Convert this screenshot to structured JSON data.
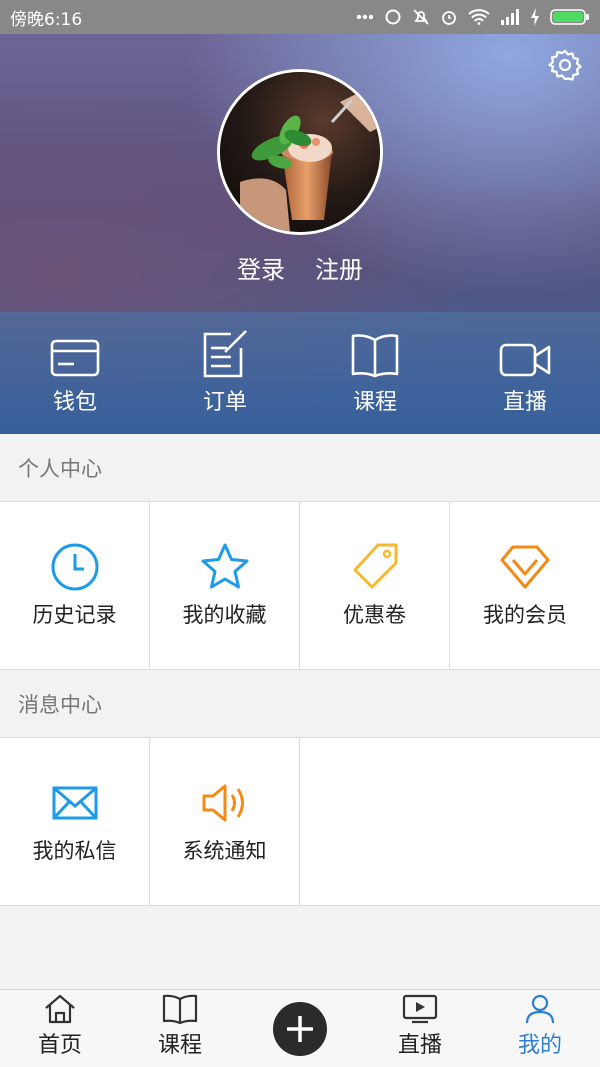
{
  "status_bar": {
    "time": "傍晚6:16",
    "icons": [
      "more-dots-icon",
      "sync-icon",
      "mute-icon",
      "alarm-icon",
      "wifi-icon",
      "signal-icon",
      "charging-icon",
      "battery-icon"
    ]
  },
  "header": {
    "settings_icon": "gear-icon",
    "avatar": "drink-photo",
    "login_label": "登录",
    "register_label": "注册"
  },
  "quick_actions": [
    {
      "label": "钱包",
      "icon": "wallet-icon"
    },
    {
      "label": "订单",
      "icon": "order-icon"
    },
    {
      "label": "课程",
      "icon": "book-icon"
    },
    {
      "label": "直播",
      "icon": "video-icon"
    }
  ],
  "personal_center": {
    "title": "个人中心",
    "items": [
      {
        "label": "历史记录",
        "icon": "clock-icon",
        "color": "#1e9be8"
      },
      {
        "label": "我的收藏",
        "icon": "star-icon",
        "color": "#1e9be8"
      },
      {
        "label": "优惠卷",
        "icon": "tag-icon",
        "color": "#f5b82e"
      },
      {
        "label": "我的会员",
        "icon": "diamond-icon",
        "color": "#f28a14"
      }
    ]
  },
  "message_center": {
    "title": "消息中心",
    "items": [
      {
        "label": "我的私信",
        "icon": "mail-icon",
        "color": "#1e9be8"
      },
      {
        "label": "系统通知",
        "icon": "speaker-icon",
        "color": "#f28a14"
      }
    ]
  },
  "bottom_nav": {
    "items": [
      {
        "label": "首页",
        "icon": "home-icon"
      },
      {
        "label": "课程",
        "icon": "book-icon"
      },
      {
        "label": "",
        "icon": "plus-icon"
      },
      {
        "label": "直播",
        "icon": "tv-play-icon"
      },
      {
        "label": "我的",
        "icon": "user-icon",
        "active": true
      }
    ],
    "active_color": "#2d7fd1"
  }
}
